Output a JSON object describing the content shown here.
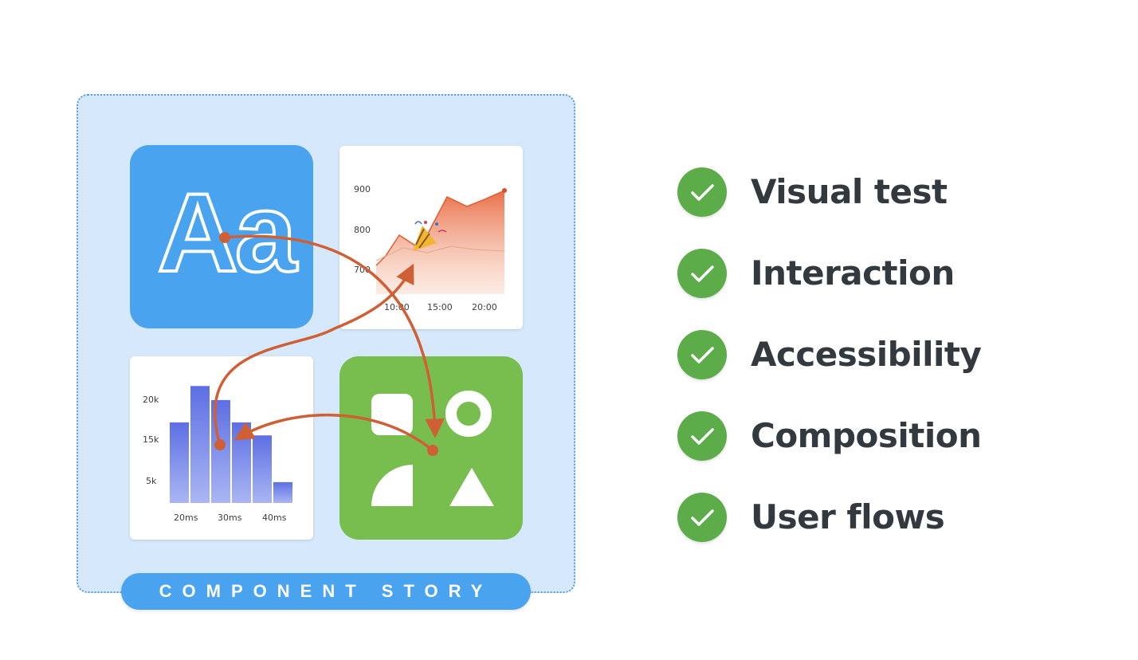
{
  "illustration": {
    "typography_sample": "Aa",
    "area_chart": {
      "y_ticks": [
        "900",
        "800",
        "700"
      ],
      "x_ticks": [
        "10:00",
        "15:00",
        "20:00"
      ]
    },
    "histogram": {
      "y_ticks": [
        "20k",
        "15k",
        "5k"
      ],
      "x_ticks": [
        "20ms",
        "30ms",
        "40ms"
      ],
      "values": [
        15500,
        22500,
        19800,
        15500,
        13000,
        4000
      ]
    },
    "label": "COMPONENT STORY"
  },
  "checklist": {
    "items": [
      {
        "label": "Visual test"
      },
      {
        "label": "Interaction"
      },
      {
        "label": "Accessibility"
      },
      {
        "label": "Composition"
      },
      {
        "label": "User flows"
      }
    ]
  },
  "colors": {
    "box_bg": "#d6e8fb",
    "blue_accent": "#4aa3ef",
    "green_accent": "#78be4f",
    "arrow": "#cf5f35",
    "check_green": "#5cad4a"
  }
}
